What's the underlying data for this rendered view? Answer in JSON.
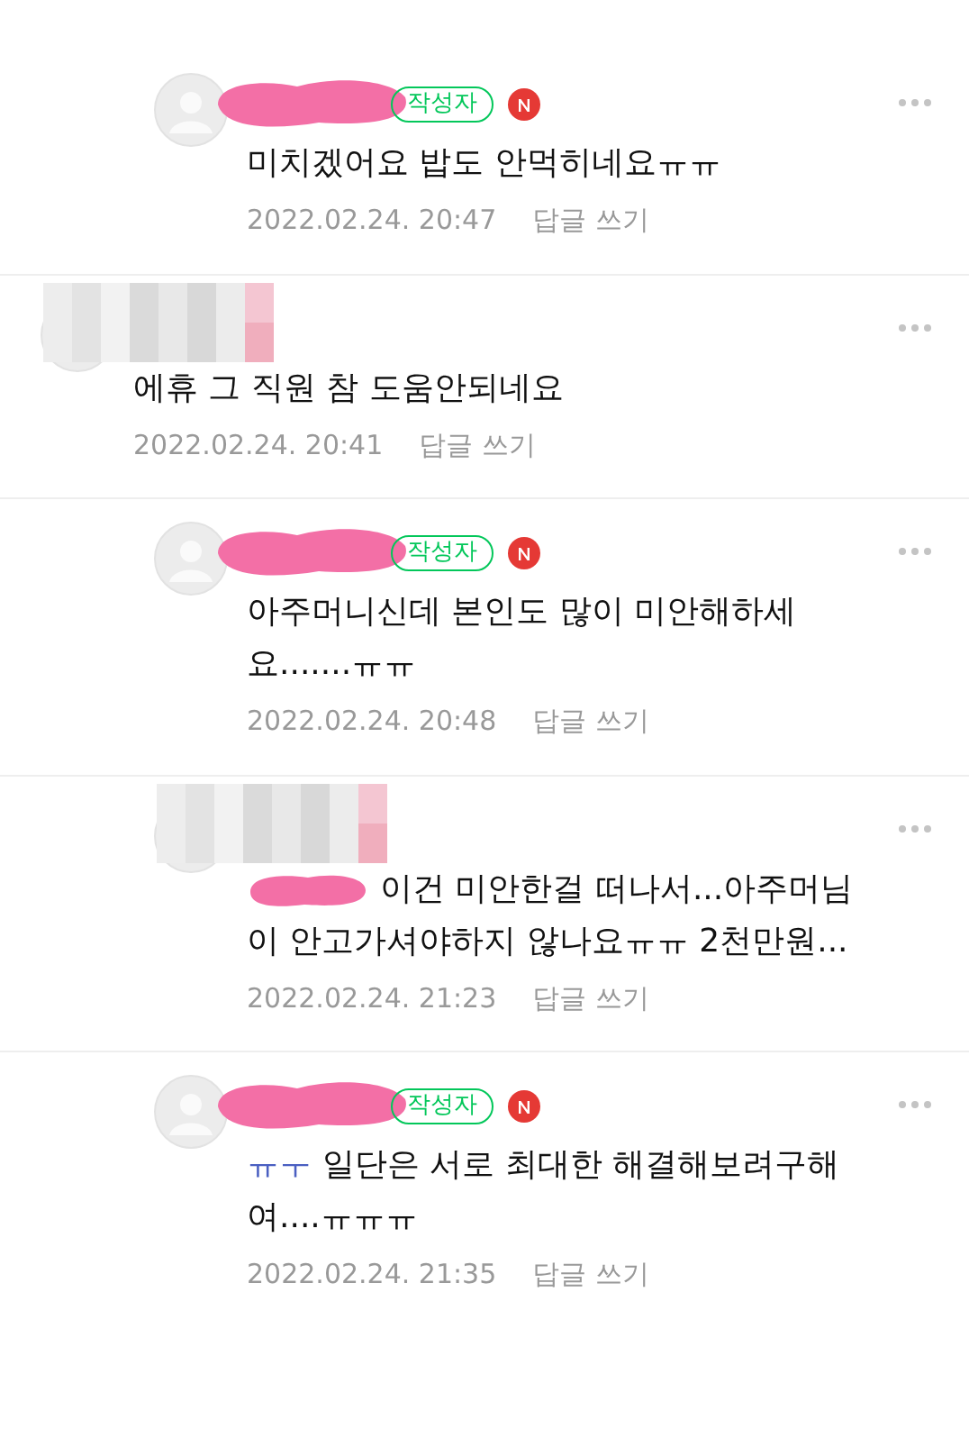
{
  "comments": [
    {
      "kind": "reply",
      "name_pixelated": false,
      "author_badge": "작성자",
      "new": true,
      "text": "미치겠어요 밥도 안먹히네요ㅠㅠ",
      "time": "2022.02.24. 20:47",
      "reply_link": "답글 쓰기"
    },
    {
      "kind": "comment",
      "name_pixelated": true,
      "text": "에휴 그 직원 참 도움안되네요",
      "time": "2022.02.24. 20:41",
      "reply_link": "답글 쓰기"
    },
    {
      "kind": "reply",
      "name_pixelated": false,
      "author_badge": "작성자",
      "new": true,
      "text": "아주머니신데 본인도 많이 미안해하세요.......ㅠㅠ",
      "time": "2022.02.24. 20:48",
      "reply_link": "답글 쓰기"
    },
    {
      "kind": "reply",
      "name_pixelated": true,
      "mention_redacted": true,
      "text": "이건 미안한걸 떠나서...아주머님이 안고가셔야하지 않나요ㅠㅠ 2천만원...",
      "time": "2022.02.24. 21:23",
      "reply_link": "답글 쓰기"
    },
    {
      "kind": "reply",
      "name_pixelated": false,
      "author_badge": "작성자",
      "new": true,
      "mention": "ㅠㅜ",
      "text": "일단은 서로 최대한 해결해보려구해여....ㅠㅠㅠ",
      "time": "2022.02.24. 21:35",
      "reply_link": "답글 쓰기"
    }
  ]
}
